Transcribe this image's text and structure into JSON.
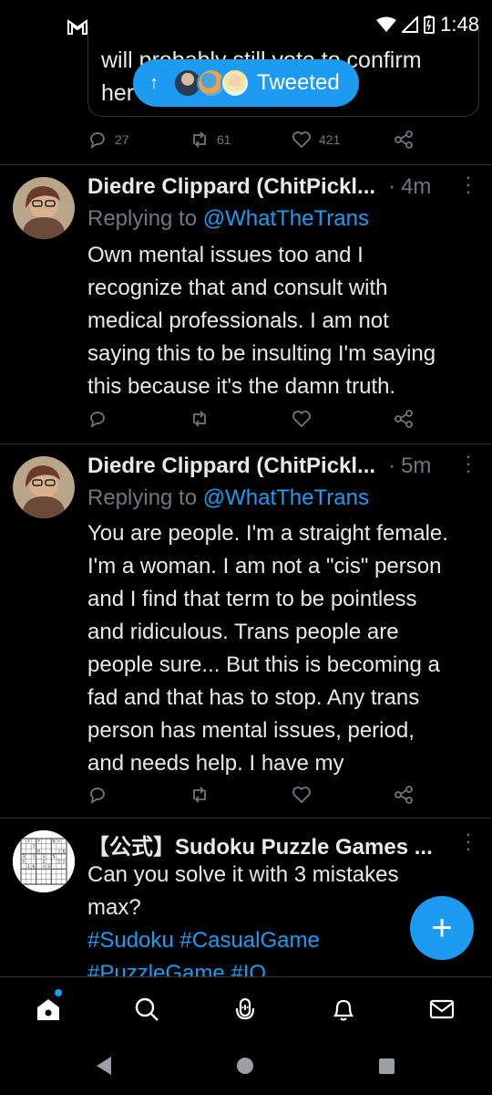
{
  "status_bar": {
    "time": "1:48"
  },
  "quoted_tweet": {
    "text_line1": "will probably still vote to confirm",
    "text_line2": "her"
  },
  "tweeted_pill": {
    "label": "Tweeted"
  },
  "top_actions": {
    "replies": "27",
    "retweets": "61",
    "likes": "421"
  },
  "tweets": [
    {
      "name": "Diedre Clippard (ChitPickl...",
      "dot": "·",
      "time": "4m",
      "replying_prefix": "Replying to ",
      "replying_handle": "@WhatTheTrans",
      "lines": [
        "Own mental issues too and I",
        "recognize that and consult with",
        "medical professionals. I am not",
        "saying this to be insulting I'm saying",
        "this because it's the damn truth."
      ]
    },
    {
      "name": "Diedre Clippard (ChitPickl...",
      "dot": "·",
      "time": "5m",
      "replying_prefix": "Replying to ",
      "replying_handle": "@WhatTheTrans",
      "lines": [
        "You are people. I'm a straight female.",
        "I'm a woman. I am not a \"cis\" person",
        "and I find that term to be pointless",
        "and ridiculous. Trans people are",
        "people sure... But this is becoming a",
        "fad and that has to stop. Any trans",
        "person has mental issues, period,",
        "and needs help. I have my"
      ]
    }
  ],
  "promoted_tweet": {
    "name": "【公式】Sudoku Puzzle Games ...",
    "line1": "Can you solve it with 3 mistakes",
    "line2": "max?",
    "hashtags1": "#Sudoku #CasualGame",
    "hashtags2": "#PuzzleGame #IQ",
    "sudoku_digits": [
      "4",
      "7",
      "8",
      "6",
      "7",
      "9",
      "3",
      "6",
      "3",
      "4",
      "1",
      "5",
      "8",
      "2",
      "5",
      "9",
      "1",
      "6",
      "4",
      "3"
    ]
  },
  "fab": {
    "label": "+"
  },
  "colors": {
    "accent": "#1d9bf0",
    "muted": "#71767b",
    "divider": "#2f3336"
  },
  "nav_icons": [
    "home-icon",
    "search-icon",
    "spaces-icon",
    "notifications-icon",
    "messages-icon"
  ]
}
